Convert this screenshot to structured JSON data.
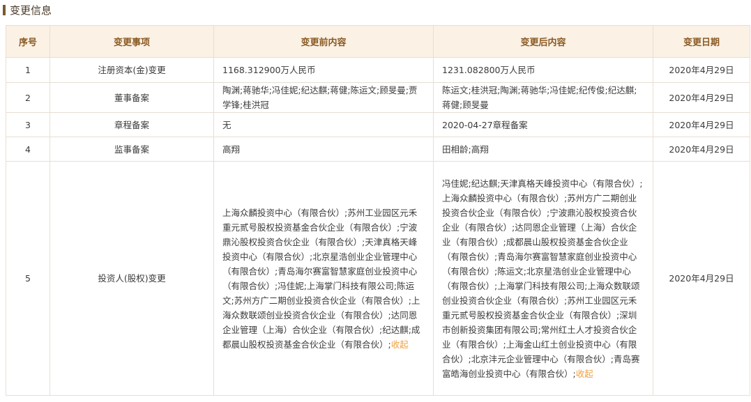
{
  "section": {
    "title": "变更信息"
  },
  "table": {
    "headers": [
      "序号",
      "变更事项",
      "变更前内容",
      "变更后内容",
      "变更日期"
    ],
    "collapse_label": "收起",
    "rows": [
      {
        "no": "1",
        "item": "注册资本(金)变更",
        "before": "1168.312900万人民币",
        "after": "1231.082800万人民币",
        "date": "2020年4月29日"
      },
      {
        "no": "2",
        "item": "董事备案",
        "before": "陶渊;蒋驰华;冯佳妮;纪达麒;蒋健;陈运文;顾旻曼;贾学锋;桂洪冠",
        "after": "陈运文;桂洪冠;陶渊;蒋驰华;冯佳妮;纪传俊;纪达麒;蒋健;顾旻曼",
        "date": "2020年4月29日"
      },
      {
        "no": "3",
        "item": "章程备案",
        "before": "无",
        "after": "2020-04-27章程备案",
        "date": "2020年4月29日"
      },
      {
        "no": "4",
        "item": "监事备案",
        "before": "高翔",
        "after": "田相龄;高翔",
        "date": "2020年4月29日"
      },
      {
        "no": "5",
        "item": "投资人(股权)变更",
        "before": "上海众麟投资中心（有限合伙）;苏州工业园区元禾重元贰号股权投资基金合伙企业（有限合伙）;宁波鼎沁股权投资合伙企业（有限合伙）;天津真格天峰投资中心（有限合伙）;北京星浩创业企业管理中心（有限合伙）;青岛海尔赛富智慧家庭创业投资中心（有限合伙）;冯佳妮;上海掌门科技有限公司;陈运文;苏州方广二期创业投资合伙企业（有限合伙）;上海众数联颂创业投资合伙企业（有限合伙）;达同恩企业管理（上海）合伙企业（有限合伙）;纪达麒;成都晨山股权投资基金合伙企业（有限合伙）;",
        "after": "冯佳妮;纪达麒;天津真格天峰投资中心（有限合伙）;上海众麟投资中心（有限合伙）;苏州方广二期创业投资合伙企业（有限合伙）;宁波鼎沁股权投资合伙企业（有限合伙）;达同恩企业管理（上海）合伙企业（有限合伙）;成都晨山股权投资基金合伙企业（有限合伙）;青岛海尔赛富智慧家庭创业投资中心（有限合伙）;陈运文;北京星浩创业企业管理中心（有限合伙）;上海掌门科技有限公司;上海众数联颂创业投资合伙企业（有限合伙）;苏州工业园区元禾重元贰号股权投资基金合伙企业（有限合伙）;深圳市创新投资集团有限公司;常州红土人才投资合伙企业（有限合伙）;上海金山红土创业投资中心（有限合伙）;北京沣元企业管理中心（有限合伙）;青岛赛富皓海创业投资中心（有限合伙）;",
        "date": "2020年4月29日"
      }
    ]
  }
}
